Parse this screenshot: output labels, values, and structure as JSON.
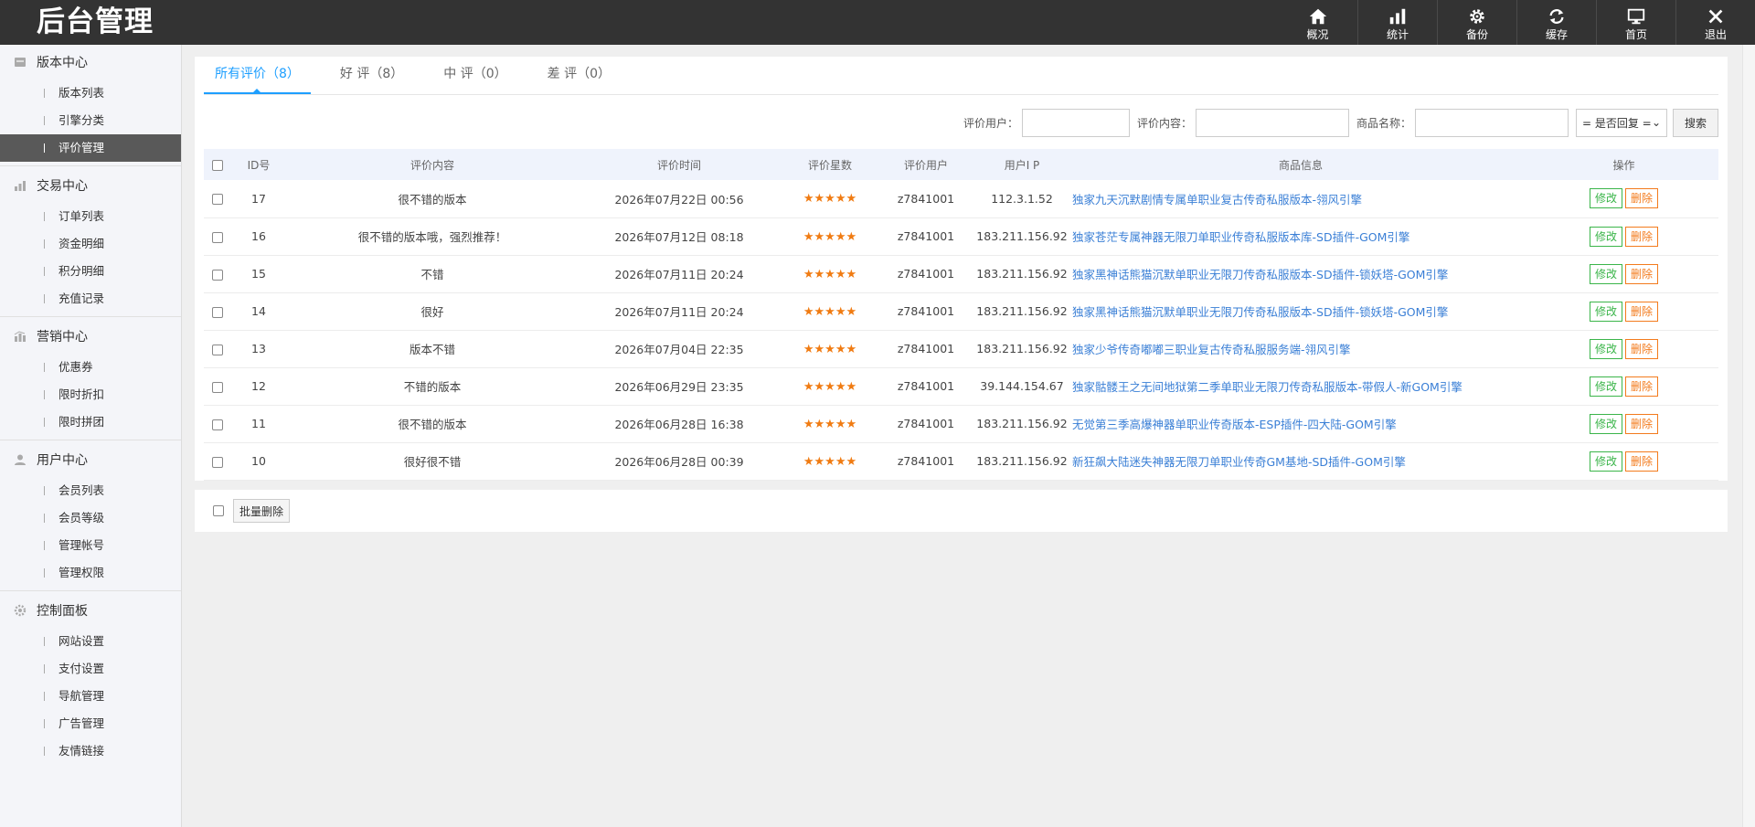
{
  "header": {
    "logo": "后台管理",
    "nav": [
      {
        "label": "概况",
        "icon": "home-icon"
      },
      {
        "label": "统计",
        "icon": "bar-chart-icon"
      },
      {
        "label": "备份",
        "icon": "gear-icon"
      },
      {
        "label": "缓存",
        "icon": "refresh-icon"
      },
      {
        "label": "首页",
        "icon": "monitor-icon"
      },
      {
        "label": "退出",
        "icon": "close-icon"
      }
    ]
  },
  "sidebar": {
    "groups": [
      {
        "title": "版本中心",
        "icon": "version-icon",
        "items": [
          "版本列表",
          "引擎分类",
          "评价管理"
        ]
      },
      {
        "title": "交易中心",
        "icon": "chart-icon",
        "items": [
          "订单列表",
          "资金明细",
          "积分明细",
          "充值记录"
        ]
      },
      {
        "title": "营销中心",
        "icon": "marketing-icon",
        "items": [
          "优惠券",
          "限时折扣",
          "限时拼团"
        ]
      },
      {
        "title": "用户中心",
        "icon": "user-icon",
        "items": [
          "会员列表",
          "会员等级",
          "管理帐号",
          "管理权限"
        ]
      },
      {
        "title": "控制面板",
        "icon": "gear-icon",
        "items": [
          "网站设置",
          "支付设置",
          "导航管理",
          "广告管理",
          "友情链接"
        ]
      }
    ],
    "active_item": "评价管理"
  },
  "tabs": [
    "所有评价（8）",
    "好 评（8）",
    "中 评（0）",
    "差 评（0）"
  ],
  "search": {
    "user_label": "评价用户：",
    "content_label": "评价内容：",
    "goods_label": "商品名称：",
    "reply_select": "= 是否回复 =",
    "button": "搜索"
  },
  "table": {
    "headers": [
      "ID号",
      "评价内容",
      "评价时间",
      "评价星数",
      "评价用户",
      "用户I P",
      "商品信息",
      "操作"
    ],
    "rows": [
      {
        "id": "17",
        "content": "很不错的版本",
        "time": "2026年07月22日 00:56",
        "stars": "★★★★★",
        "user": "z7841001",
        "ip": "112.3.1.52",
        "goods": "独家九天沉默剧情专属单职业复古传奇私服版本-翎风引擎"
      },
      {
        "id": "16",
        "content": "很不错的版本哦，强烈推荐！",
        "time": "2026年07月12日 08:18",
        "stars": "★★★★★",
        "user": "z7841001",
        "ip": "183.211.156.92",
        "goods": "独家苍茫专属神器无限刀单职业传奇私服版本库-SD插件-GOM引擎"
      },
      {
        "id": "15",
        "content": "不错",
        "time": "2026年07月11日 20:24",
        "stars": "★★★★★",
        "user": "z7841001",
        "ip": "183.211.156.92",
        "goods": "独家黑神话熊猫沉默单职业无限刀传奇私服版本-SD插件-锁妖塔-GOM引擎"
      },
      {
        "id": "14",
        "content": "很好",
        "time": "2026年07月11日 20:24",
        "stars": "★★★★★",
        "user": "z7841001",
        "ip": "183.211.156.92",
        "goods": "独家黑神话熊猫沉默单职业无限刀传奇私服版本-SD插件-锁妖塔-GOM引擎"
      },
      {
        "id": "13",
        "content": "版本不错",
        "time": "2026年07月04日 22:35",
        "stars": "★★★★★",
        "user": "z7841001",
        "ip": "183.211.156.92",
        "goods": "独家少爷传奇嘟嘟三职业复古传奇私服服务端-翎风引擎"
      },
      {
        "id": "12",
        "content": "不错的版本",
        "time": "2026年06月29日 23:35",
        "stars": "★★★★★",
        "user": "z7841001",
        "ip": "39.144.154.67",
        "goods": "独家骷髅王之无间地狱第二季单职业无限刀传奇私服版本-带假人-新GOM引擎"
      },
      {
        "id": "11",
        "content": "很不错的版本",
        "time": "2026年06月28日 16:38",
        "stars": "★★★★★",
        "user": "z7841001",
        "ip": "183.211.156.92",
        "goods": "无觉第三季高爆神器单职业传奇版本-ESP插件-四大陆-GOM引擎"
      },
      {
        "id": "10",
        "content": "很好很不错",
        "time": "2026年06月28日 00:39",
        "stars": "★★★★★",
        "user": "z7841001",
        "ip": "183.211.156.92",
        "goods": "新狂飙大陆迷失神器无限刀单职业传奇GM基地-SD插件-GOM引擎"
      }
    ],
    "edit_label": "修改",
    "delete_label": "删除"
  },
  "footer": {
    "bulk_delete": "批量删除"
  },
  "colors": {
    "header_bg": "#333333",
    "active_tab": "#1e9fff",
    "link": "#3a7fd6",
    "star": "#f07b12",
    "edit": "#3bb54a",
    "delete": "#f37b1d"
  }
}
